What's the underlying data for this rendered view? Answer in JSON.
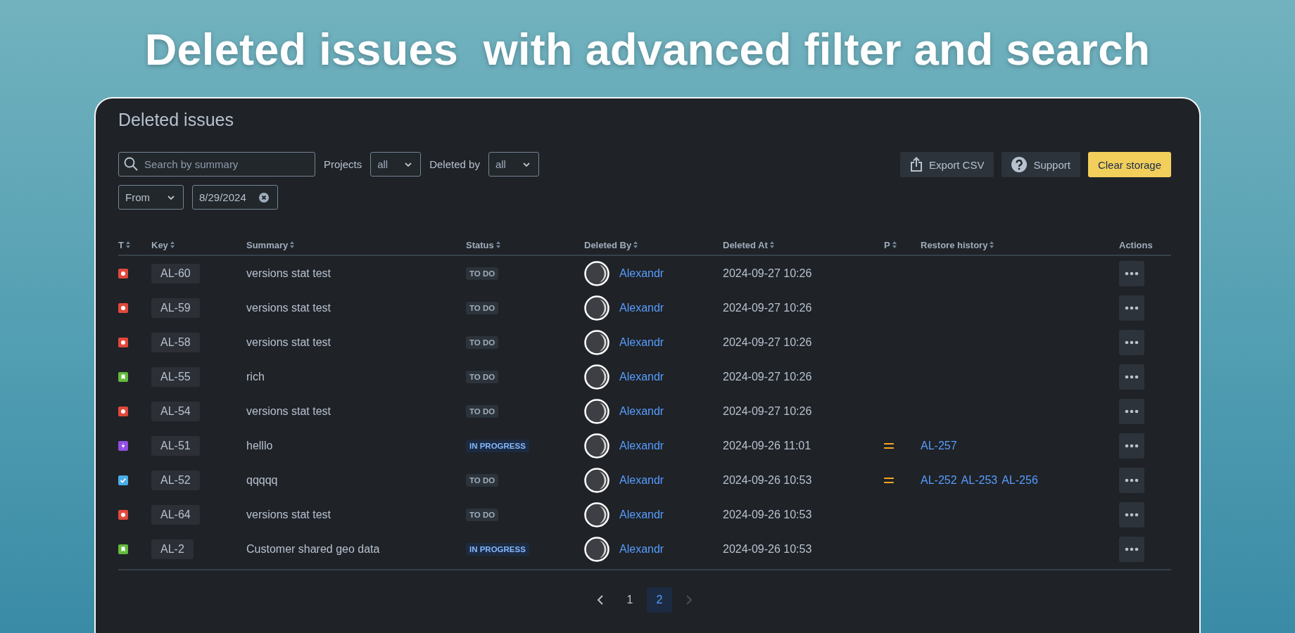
{
  "headline": "Deleted issues  with advanced filter and search",
  "window": {
    "title": "Deleted issues"
  },
  "filters": {
    "search": {
      "placeholder": "Search by summary"
    },
    "projects": {
      "label": "Projects",
      "value": "all"
    },
    "deleted_by": {
      "label": "Deleted by",
      "value": "all"
    },
    "date_mode": {
      "value": "From"
    },
    "date": {
      "value": "8/29/2024"
    }
  },
  "actions": [
    {
      "kind": "export",
      "label": "Export CSV"
    },
    {
      "kind": "support",
      "label": "Support"
    },
    {
      "kind": "primary",
      "label": "Clear storage"
    }
  ],
  "table": {
    "columns": [
      {
        "label": "T",
        "sortable": true
      },
      {
        "label": "Key",
        "sortable": true
      },
      {
        "label": "Summary",
        "sortable": true
      },
      {
        "label": "Status",
        "sortable": true
      },
      {
        "label": "Deleted By",
        "sortable": true
      },
      {
        "label": "Deleted At",
        "sortable": true
      },
      {
        "label": "P",
        "sortable": true
      },
      {
        "label": "Restore history",
        "sortable": true
      },
      {
        "label": "Actions",
        "sortable": false
      }
    ],
    "rows": [
      {
        "kind": "bug",
        "key": "AL-60",
        "summary": "versions stat test",
        "status": {
          "kind": "todo",
          "label": "TO DO"
        },
        "deleted_by": "Alexandr",
        "deleted_at": "2024-09-27 10:26",
        "restore_history": []
      },
      {
        "kind": "bug",
        "key": "AL-59",
        "summary": "versions stat test",
        "status": {
          "kind": "todo",
          "label": "TO DO"
        },
        "deleted_by": "Alexandr",
        "deleted_at": "2024-09-27 10:26",
        "restore_history": []
      },
      {
        "kind": "bug",
        "key": "AL-58",
        "summary": "versions stat test",
        "status": {
          "kind": "todo",
          "label": "TO DO"
        },
        "deleted_by": "Alexandr",
        "deleted_at": "2024-09-27 10:26",
        "restore_history": []
      },
      {
        "kind": "story",
        "key": "AL-55",
        "summary": "rich",
        "status": {
          "kind": "todo",
          "label": "TO DO"
        },
        "deleted_by": "Alexandr",
        "deleted_at": "2024-09-27 10:26",
        "restore_history": []
      },
      {
        "kind": "bug",
        "key": "AL-54",
        "summary": "versions stat test",
        "status": {
          "kind": "todo",
          "label": "TO DO"
        },
        "deleted_by": "Alexandr",
        "deleted_at": "2024-09-27 10:26",
        "restore_history": []
      },
      {
        "kind": "epic",
        "key": "AL-51",
        "summary": "helllo",
        "status": {
          "kind": "inprogress",
          "label": "IN PROGRESS"
        },
        "deleted_by": "Alexandr",
        "deleted_at": "2024-09-26 11:01",
        "priority": {
          "kind": "medium"
        },
        "restore_history": [
          "AL-257"
        ]
      },
      {
        "kind": "task",
        "key": "AL-52",
        "summary": "qqqqq",
        "status": {
          "kind": "todo",
          "label": "TO DO"
        },
        "deleted_by": "Alexandr",
        "deleted_at": "2024-09-26 10:53",
        "priority": {
          "kind": "medium"
        },
        "restore_history": [
          "AL-252",
          "AL-253",
          "AL-256"
        ]
      },
      {
        "kind": "bug",
        "key": "AL-64",
        "summary": "versions stat test",
        "status": {
          "kind": "todo",
          "label": "TO DO"
        },
        "deleted_by": "Alexandr",
        "deleted_at": "2024-09-26 10:53",
        "restore_history": []
      },
      {
        "kind": "story",
        "key": "AL-2",
        "summary": "Customer shared geo data",
        "status": {
          "kind": "inprogress",
          "label": "IN PROGRESS"
        },
        "deleted_by": "Alexandr",
        "deleted_at": "2024-09-26 10:53",
        "restore_history": []
      }
    ]
  },
  "pagination": {
    "prev_disabled": false,
    "next_disabled": true,
    "pages": [
      {
        "label": "1",
        "selected": false
      },
      {
        "label": "2",
        "selected": true
      }
    ]
  }
}
